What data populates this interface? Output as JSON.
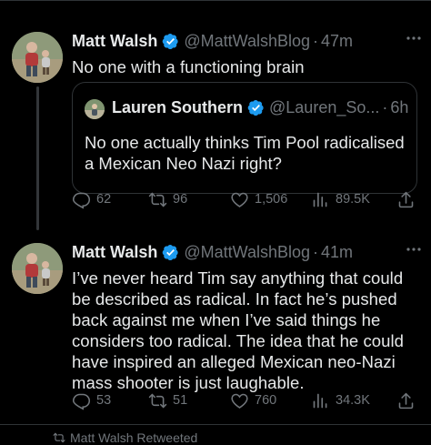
{
  "colors": {
    "background": "#000000",
    "text_primary": "#e7e9ea",
    "text_secondary": "#71767b",
    "verified_blue": "#1d9bf0",
    "divider": "#2f3336"
  },
  "tweets": [
    {
      "author": {
        "display_name": "Matt Walsh",
        "handle": "@MattWalshBlog",
        "verified_icon": "verified-badge-icon"
      },
      "separator": "·",
      "time": "47m",
      "text_lines": [
        "No one with a functioning brain"
      ],
      "quote": {
        "author": {
          "display_name": "Lauren Southern",
          "handle": "@Lauren_So...",
          "verified_icon": "verified-badge-icon"
        },
        "separator": "·",
        "time": "6h",
        "text_lines": [
          "No one actually thinks Tim Pool radicalised",
          "a Mexican Neo Nazi right?"
        ]
      },
      "metrics": {
        "replies": "62",
        "reposts": "96",
        "likes": "1,506",
        "views": "89.5K"
      }
    },
    {
      "author": {
        "display_name": "Matt Walsh",
        "handle": "@MattWalshBlog",
        "verified_icon": "verified-badge-icon"
      },
      "separator": "·",
      "time": "41m",
      "text_lines": [
        "I’ve never heard Tim say anything that could",
        "be described as radical. In fact he’s pushed",
        "back against me when I’ve said things he",
        "considers too radical. The idea that he could",
        "have inspired an alleged Mexican neo-Nazi",
        "mass shooter is just laughable."
      ],
      "metrics": {
        "replies": "53",
        "reposts": "51",
        "likes": "760",
        "views": "34.3K"
      }
    }
  ],
  "next_item_peek": "Matt Walsh Retweeted"
}
